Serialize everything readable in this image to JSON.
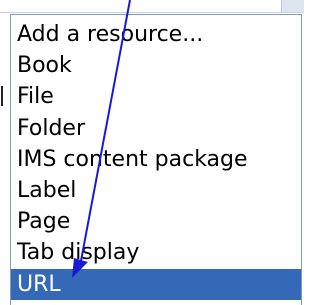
{
  "dropdown": {
    "items": [
      {
        "label": "Add a resource...",
        "selected": false
      },
      {
        "label": "Book",
        "selected": false
      },
      {
        "label": "File",
        "selected": false
      },
      {
        "label": "Folder",
        "selected": false
      },
      {
        "label": "IMS content package",
        "selected": false
      },
      {
        "label": "Label",
        "selected": false
      },
      {
        "label": "Page",
        "selected": false
      },
      {
        "label": "Tab display",
        "selected": false
      },
      {
        "label": "URL",
        "selected": true
      }
    ]
  },
  "colors": {
    "selection_background": "#3469b8",
    "selection_text": "#ffffff",
    "list_border": "#7f9db9",
    "arrow": "#1a1ad6"
  },
  "annotation": {
    "type": "arrow",
    "points_to": "URL"
  }
}
